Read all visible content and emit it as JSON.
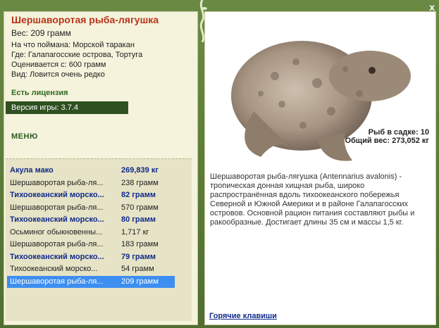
{
  "close_label": "x",
  "fish": {
    "title": "Шершаворотая рыба-лягушка",
    "weight": "Вес: 209 грамм",
    "bait": "На что поймана: Морской таракан",
    "place": "Где: Галапагосские острова, Тортуга",
    "valued": "Оценивается с: 600 грамм",
    "kind": "Вид: Ловится очень редко",
    "description": "Шершаворотая рыба-лягушка (Antennarius avalonis) - тропическая донная хищная рыба, широко распространённая вдоль тихоокеанского побережья Северной и Южной Америки и в районе Галапагосских островов. Основной рацион питания составляют рыбы и ракообразные. Достигает длины 35 см и массы 1,5 кг."
  },
  "license": "Есть лицензия",
  "version": "Версия игры: 3.7.4",
  "menu_label": "МЕНЮ",
  "cage": {
    "count": "Рыб в садке: 10",
    "total": "Общий вес: 273,052 кг"
  },
  "catch_list": [
    {
      "name": "Акула мако",
      "weight": "269,839 кг",
      "bold": true
    },
    {
      "name": "Шершаворотая рыба-ля...",
      "weight": "238 грамм",
      "bold": false
    },
    {
      "name": "Тихоокеанский морско...",
      "weight": "82 грамм",
      "bold": true
    },
    {
      "name": "Шершаворотая рыба-ля...",
      "weight": "570 грамм",
      "bold": false
    },
    {
      "name": "Тихоокеанский морско...",
      "weight": "80 грамм",
      "bold": true
    },
    {
      "name": "Осьминог обыкновенны...",
      "weight": "1,717 кг",
      "bold": false
    },
    {
      "name": "Шершаворотая рыба-ля...",
      "weight": "183 грамм",
      "bold": false
    },
    {
      "name": "Тихоокеанский морско...",
      "weight": "79 грамм",
      "bold": true
    },
    {
      "name": "Тихоокеанский морско...",
      "weight": "54 грамм",
      "bold": false
    },
    {
      "name": "Шершаворотая рыба-ля...",
      "weight": "209 грамм",
      "bold": false,
      "selected": true
    }
  ],
  "hotkeys": "Горячие клавиши",
  "colors": {
    "title": "#b8341a",
    "frame": "#5a7a3a",
    "selection": "#3c8ef0",
    "link": "#102a8a"
  }
}
